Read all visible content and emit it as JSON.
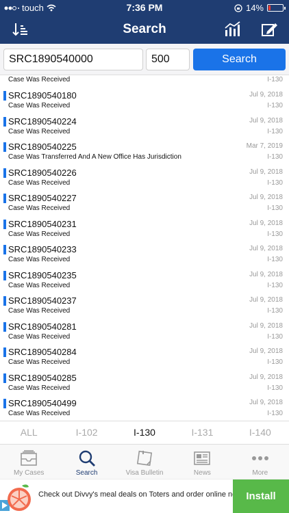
{
  "status_bar": {
    "carrier": "touch",
    "time": "7:36 PM",
    "battery": "14%",
    "battery_level": 0.14
  },
  "nav": {
    "title": "Search"
  },
  "search": {
    "case_number": "SRC1890540000",
    "count": "500",
    "button_label": "Search"
  },
  "partial_row": {
    "status": "Case Was Received",
    "form": "I-130"
  },
  "rows": [
    {
      "case": "SRC1890540180",
      "status": "Case Was Received",
      "date": "Jul 9, 2018",
      "form": "I-130"
    },
    {
      "case": "SRC1890540224",
      "status": "Case Was Received",
      "date": "Jul 9, 2018",
      "form": "I-130"
    },
    {
      "case": "SRC1890540225",
      "status": "Case Was Transferred And A New Office Has Jurisdiction",
      "date": "Mar 7, 2019",
      "form": "I-130"
    },
    {
      "case": "SRC1890540226",
      "status": "Case Was Received",
      "date": "Jul 9, 2018",
      "form": "I-130"
    },
    {
      "case": "SRC1890540227",
      "status": "Case Was Received",
      "date": "Jul 9, 2018",
      "form": "I-130"
    },
    {
      "case": "SRC1890540231",
      "status": "Case Was Received",
      "date": "Jul 9, 2018",
      "form": "I-130"
    },
    {
      "case": "SRC1890540233",
      "status": "Case Was Received",
      "date": "Jul 9, 2018",
      "form": "I-130"
    },
    {
      "case": "SRC1890540235",
      "status": "Case Was Received",
      "date": "Jul 9, 2018",
      "form": "I-130"
    },
    {
      "case": "SRC1890540237",
      "status": "Case Was Received",
      "date": "Jul 9, 2018",
      "form": "I-130"
    },
    {
      "case": "SRC1890540281",
      "status": "Case Was Received",
      "date": "Jul 9, 2018",
      "form": "I-130"
    },
    {
      "case": "SRC1890540284",
      "status": "Case Was Received",
      "date": "Jul 9, 2018",
      "form": "I-130"
    },
    {
      "case": "SRC1890540285",
      "status": "Case Was Received",
      "date": "Jul 9, 2018",
      "form": "I-130"
    },
    {
      "case": "SRC1890540499",
      "status": "Case Was Received",
      "date": "Jul 9, 2018",
      "form": "I-130"
    }
  ],
  "filters": [
    {
      "label": "ALL",
      "active": false
    },
    {
      "label": "I-102",
      "active": false
    },
    {
      "label": "I-130",
      "active": true
    },
    {
      "label": "I-131",
      "active": false
    },
    {
      "label": "I-140",
      "active": false
    }
  ],
  "tabs": [
    {
      "label": "My Cases",
      "icon": "inbox-icon",
      "active": false
    },
    {
      "label": "Search",
      "icon": "search-icon",
      "active": true
    },
    {
      "label": "Visa Bulletin",
      "icon": "sticky-note-icon",
      "active": false
    },
    {
      "label": "News",
      "icon": "newspaper-icon",
      "active": false
    },
    {
      "label": "More",
      "icon": "more-dots-icon",
      "active": false
    }
  ],
  "ad": {
    "text": "Check out Divvy's meal deals on Toters and order online now!",
    "button": "Install"
  },
  "colors": {
    "nav_bg": "#1f3d72",
    "accent": "#1a73e8",
    "install_bg": "#58b949",
    "battery_low": "#ff3b30"
  }
}
